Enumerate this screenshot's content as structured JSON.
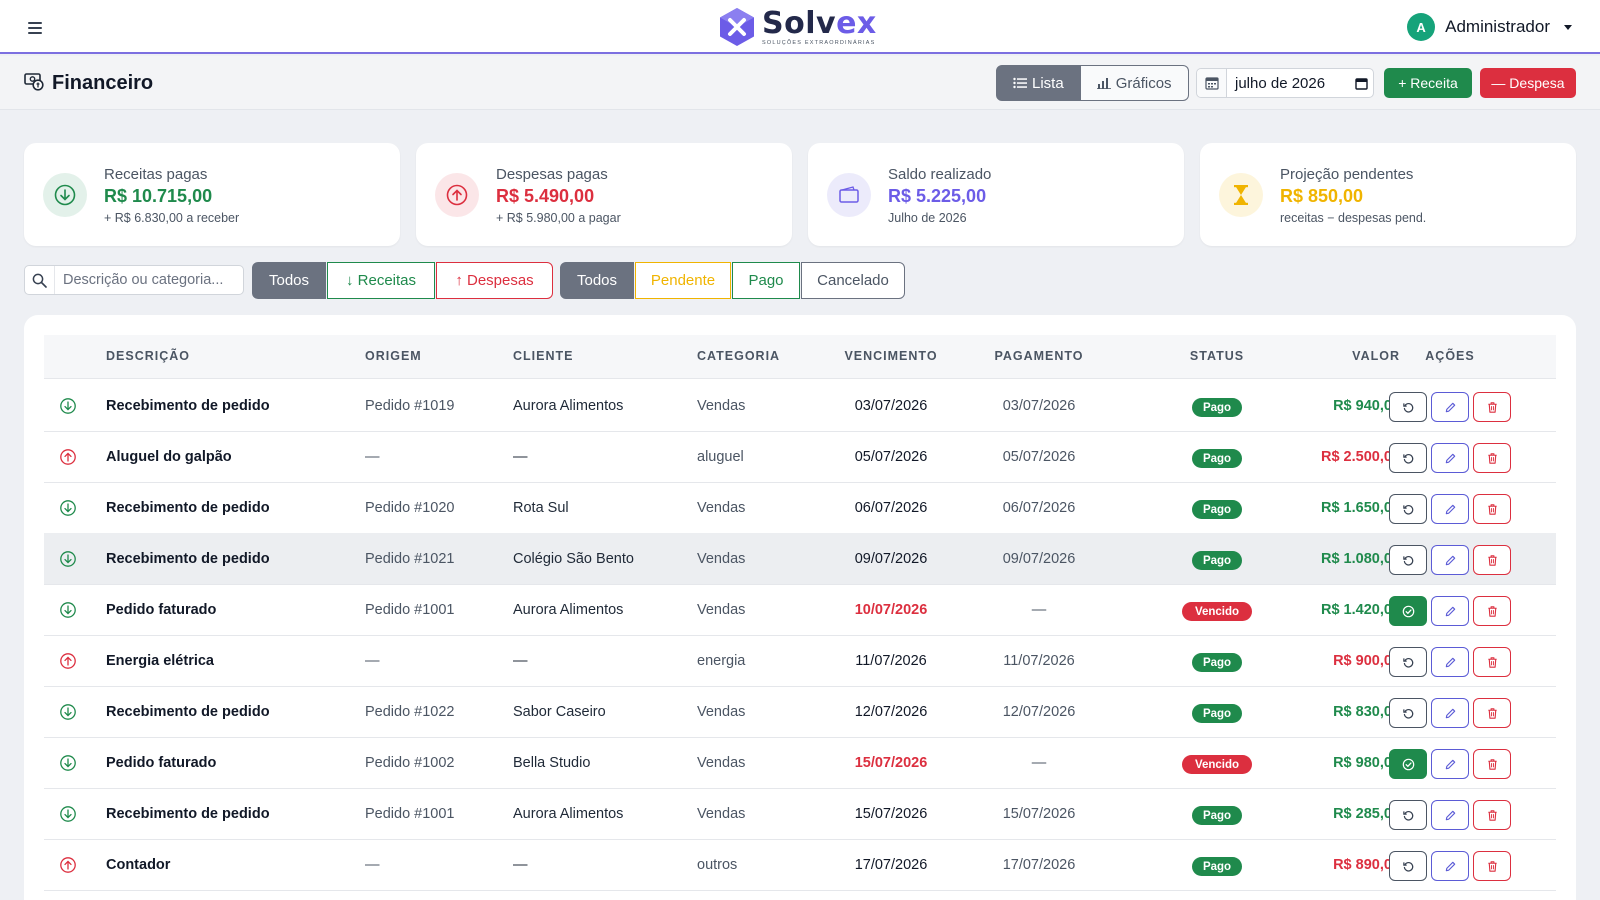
{
  "brand": {
    "name_main": "Solv",
    "name_accent": "ex",
    "tagline": "SOLUÇÕES EXTRAORDINÁRIAS"
  },
  "user": {
    "initial": "A",
    "name": "Administrador"
  },
  "page": {
    "title": "Financeiro"
  },
  "view_toggle": {
    "list_label": "Lista",
    "charts_label": "Gráficos",
    "active": "Lista"
  },
  "month_picker": {
    "value": "julho de 2026"
  },
  "actions": {
    "add_receita": "+ Receita",
    "add_despesa": "— Despesa"
  },
  "cards": [
    {
      "label": "Receitas pagas",
      "value": "R$ 10.715,00",
      "sub": "+ R$ 6.830,00 a receber",
      "color": "#1f8a4c",
      "icon": "arrow-down-circle-icon"
    },
    {
      "label": "Despesas pagas",
      "value": "R$ 5.490,00",
      "sub": "+ R$ 5.980,00 a pagar",
      "color": "#dc2f3f",
      "icon": "arrow-up-circle-icon"
    },
    {
      "label": "Saldo realizado",
      "value": "R$ 5.225,00",
      "sub": "Julho de 2026",
      "color": "#6c5ce7",
      "icon": "wallet-icon"
    },
    {
      "label": "Projeção pendentes",
      "value": "R$ 850,00",
      "sub": "receitas − despesas pend.",
      "color": "#f0b400",
      "icon": "hourglass-icon"
    }
  ],
  "search": {
    "placeholder": "Descrição ou categoria..."
  },
  "type_filters": [
    {
      "label": "Todos",
      "selected": true
    },
    {
      "label": "↓ Receitas",
      "selected": false
    },
    {
      "label": "↑ Despesas",
      "selected": false
    }
  ],
  "status_filters": [
    {
      "label": "Todos",
      "selected": true
    },
    {
      "label": "Pendente",
      "selected": false
    },
    {
      "label": "Pago",
      "selected": false
    },
    {
      "label": "Cancelado",
      "selected": false
    }
  ],
  "table": {
    "headers": [
      "DESCRIÇÃO",
      "ORIGEM",
      "CLIENTE",
      "CATEGORIA",
      "VENCIMENTO",
      "PAGAMENTO",
      "STATUS",
      "VALOR",
      "AÇÕES"
    ],
    "rows": [
      {
        "type": "in",
        "descricao": "Recebimento de pedido",
        "origem": "Pedido #1019",
        "cliente": "Aurora Alimentos",
        "categoria": "Vendas",
        "vencimento": "03/07/2026",
        "pagamento": "03/07/2026",
        "status": "Pago",
        "valor": "R$ 940,00"
      },
      {
        "type": "out",
        "descricao": "Aluguel do galpão",
        "origem": "—",
        "cliente": "—",
        "categoria": "aluguel",
        "vencimento": "05/07/2026",
        "pagamento": "05/07/2026",
        "status": "Pago",
        "valor": "R$ 2.500,00"
      },
      {
        "type": "in",
        "descricao": "Recebimento de pedido",
        "origem": "Pedido #1020",
        "cliente": "Rota Sul",
        "categoria": "Vendas",
        "vencimento": "06/07/2026",
        "pagamento": "06/07/2026",
        "status": "Pago",
        "valor": "R$ 1.650,00"
      },
      {
        "type": "in",
        "descricao": "Recebimento de pedido",
        "origem": "Pedido #1021",
        "cliente": "Colégio São Bento",
        "categoria": "Vendas",
        "vencimento": "09/07/2026",
        "pagamento": "09/07/2026",
        "status": "Pago",
        "valor": "R$ 1.080,00",
        "highlighted": true
      },
      {
        "type": "in",
        "descricao": "Pedido faturado",
        "origem": "Pedido #1001",
        "cliente": "Aurora Alimentos",
        "categoria": "Vendas",
        "vencimento": "10/07/2026",
        "pagamento": "—",
        "status": "Vencido",
        "valor": "R$ 1.420,00"
      },
      {
        "type": "out",
        "descricao": "Energia elétrica",
        "origem": "—",
        "cliente": "—",
        "categoria": "energia",
        "vencimento": "11/07/2026",
        "pagamento": "11/07/2026",
        "status": "Pago",
        "valor": "R$ 900,00"
      },
      {
        "type": "in",
        "descricao": "Recebimento de pedido",
        "origem": "Pedido #1022",
        "cliente": "Sabor Caseiro",
        "categoria": "Vendas",
        "vencimento": "12/07/2026",
        "pagamento": "12/07/2026",
        "status": "Pago",
        "valor": "R$ 830,00"
      },
      {
        "type": "in",
        "descricao": "Pedido faturado",
        "origem": "Pedido #1002",
        "cliente": "Bella Studio",
        "categoria": "Vendas",
        "vencimento": "15/07/2026",
        "pagamento": "—",
        "status": "Vencido",
        "valor": "R$ 980,00"
      },
      {
        "type": "in",
        "descricao": "Recebimento de pedido",
        "origem": "Pedido #1001",
        "cliente": "Aurora Alimentos",
        "categoria": "Vendas",
        "vencimento": "15/07/2026",
        "pagamento": "15/07/2026",
        "status": "Pago",
        "valor": "R$ 285,00"
      },
      {
        "type": "out",
        "descricao": "Contador",
        "origem": "—",
        "cliente": "—",
        "categoria": "outros",
        "vencimento": "17/07/2026",
        "pagamento": "17/07/2026",
        "status": "Pago",
        "valor": "R$ 890,00"
      }
    ]
  },
  "colors": {
    "income": "#1f8a4c",
    "expense": "#dc2f3f",
    "accent": "#6c5ce7",
    "pending": "#f0b400",
    "neutral": "#6b7280"
  }
}
